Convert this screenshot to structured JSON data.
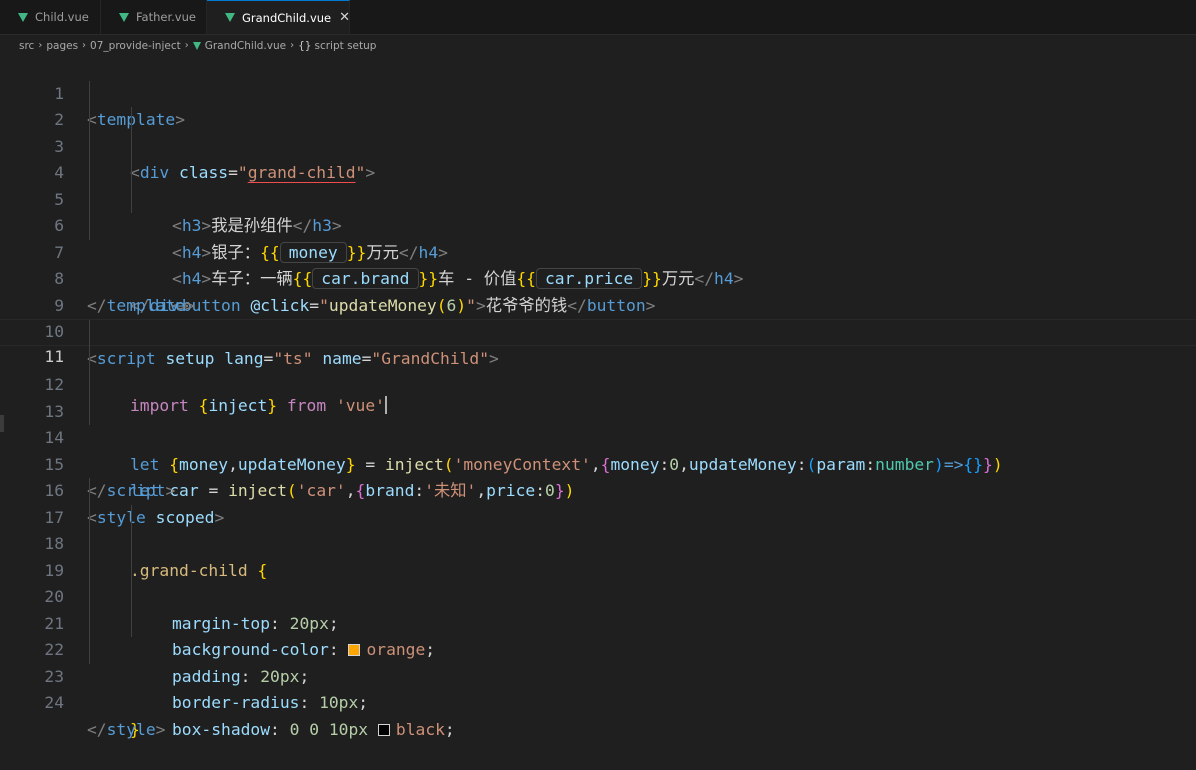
{
  "tabs": [
    {
      "label": "Child.vue",
      "active": false
    },
    {
      "label": "Father.vue",
      "active": false
    },
    {
      "label": "GrandChild.vue",
      "active": true
    }
  ],
  "tab_close_glyph": "✕",
  "breadcrumbs": {
    "items": [
      "src",
      "pages",
      "07_provide-inject",
      "GrandChild.vue",
      "script setup"
    ],
    "separator": "›",
    "braces_glyph": "{}"
  },
  "editor": {
    "line_numbers": [
      "1",
      "2",
      "3",
      "4",
      "5",
      "6",
      "7",
      "8",
      "9",
      "10",
      "11",
      "12",
      "13",
      "14",
      "15",
      "16",
      "17",
      "18",
      "19",
      "20",
      "21",
      "22",
      "23",
      "24"
    ],
    "active_line": "11",
    "swatch_colors": {
      "orange": "#ffa500",
      "black": "#000000"
    }
  },
  "icons": {
    "vue": "vue-logo-icon",
    "close": "close-icon",
    "braces": "braces-icon"
  },
  "t": {
    "lt": "<",
    "gt": ">",
    "lts": "</",
    "eq": "=",
    "q": "\"",
    "template": "template",
    "div": "div",
    "h3": "h3",
    "h4": "h4",
    "button": "button",
    "script": "script",
    "style": "style",
    "class": "class",
    "setup": "setup",
    "lang": "lang",
    "name": "name",
    "scoped": "scoped",
    "grand_child": "grand-child",
    "ts": "ts",
    "grandchild_name": "GrandChild",
    "h3_text": "我是孙组件",
    "yinzi": "银子：",
    "ob": "{{",
    "cb": "}}",
    "money": "money",
    "wanyuan": "万元",
    "chezi": "车子：一辆",
    "car_brand": "car.brand",
    "che_jiazhi": "车 - 价值",
    "car_price": "car.price",
    "click": "@click",
    "update_call": "updateMoney",
    "six": "6",
    "lp": "(",
    "rp": ")",
    "btn_text": "花爷爷的钱",
    "import": "import",
    "lb": "{",
    "rb": "}",
    "inject": "inject",
    "from": "from",
    "sq_vue": "'vue'",
    "let": "let",
    "money_v": "money",
    "comma": ",",
    "updateMoney_v": "updateMoney",
    "assign": " = ",
    "moneyContext": "'moneyContext'",
    "money_key": "money",
    "colon": ":",
    "zero": "0",
    "update_key": "updateMoney",
    "param": "param",
    "number": "number",
    "arrow": "=>",
    "car_v": "car",
    "car_str": "'car'",
    "brand_key": "brand",
    "weizhi": "'未知'",
    "price_key": "price",
    "sel": ".grand-child",
    "margin_top": "margin-top",
    "px20": "20px",
    "semi": ";",
    "bg_color": "background-color",
    "orange": "orange",
    "padding": "padding",
    "radius": "border-radius",
    "px10": "10px",
    "shadow": "box-shadow",
    "zz": "0 0 ",
    "black": "black"
  }
}
